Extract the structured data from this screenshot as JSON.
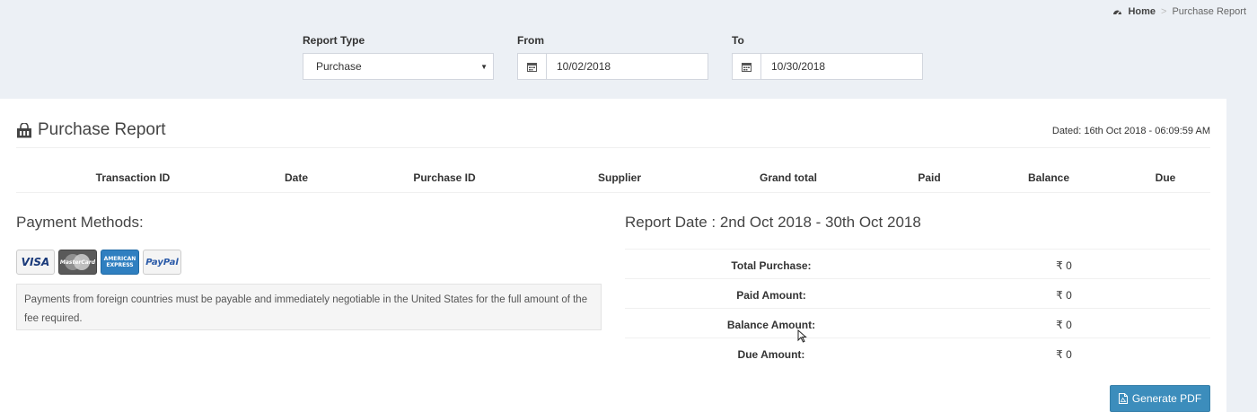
{
  "breadcrumb": {
    "home": "Home",
    "current": "Purchase Report"
  },
  "filters": {
    "report_type": {
      "label": "Report Type",
      "value": "Purchase"
    },
    "from": {
      "label": "From",
      "value": "10/02/2018"
    },
    "to": {
      "label": "To",
      "value": "10/30/2018"
    }
  },
  "report": {
    "title": "Purchase Report",
    "dated": "Dated: 16th Oct 2018 - 06:09:59 AM",
    "columns": [
      "Transaction ID",
      "Date",
      "Purchase ID",
      "Supplier",
      "Grand total",
      "Paid",
      "Balance",
      "Due"
    ]
  },
  "payment": {
    "title": "Payment Methods:",
    "cards": [
      "VISA",
      "MasterCard",
      "AMERICAN EXPRESS",
      "PayPal"
    ],
    "note": "Payments from foreign countries must be payable and immediately negotiable in the United States for the full amount of the fee required."
  },
  "summary": {
    "title": "Report Date : 2nd Oct 2018 - 30th Oct 2018",
    "rows": [
      {
        "label": "Total Purchase:",
        "amount": "₹ 0"
      },
      {
        "label": "Paid Amount:",
        "amount": "₹ 0"
      },
      {
        "label": "Balance Amount:",
        "amount": "₹ 0"
      },
      {
        "label": "Due Amount:",
        "amount": "₹ 0"
      }
    ]
  },
  "actions": {
    "generate_pdf": "Generate PDF"
  },
  "colors": {
    "accent": "#3c8dbc",
    "background": "#ecf0f5"
  }
}
